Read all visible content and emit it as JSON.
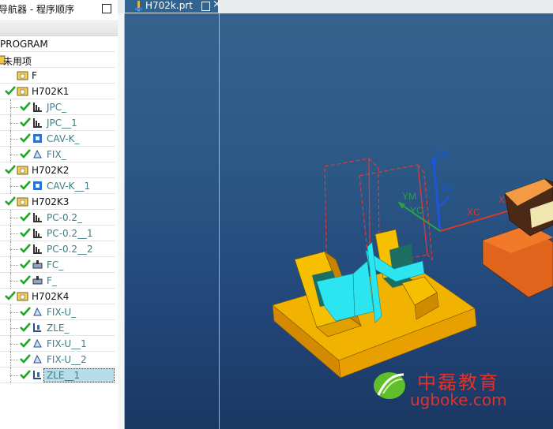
{
  "navigator": {
    "title": "导航器 - 程序顺序",
    "root": "PROGRAM",
    "unused": "未用项",
    "rows": [
      {
        "label": "F",
        "kind": "group",
        "checked": false
      },
      {
        "label": "H702K1",
        "kind": "group",
        "checked": true
      },
      {
        "label": "JPC_",
        "kind": "op",
        "icon": "planar-mill-icon",
        "checked": true
      },
      {
        "label": "JPC__1",
        "kind": "op",
        "icon": "planar-mill-icon",
        "checked": true
      },
      {
        "label": "CAV-K_",
        "kind": "op",
        "icon": "cavity-mill-icon",
        "checked": true
      },
      {
        "label": "FIX_",
        "kind": "op",
        "icon": "fixed-axis-icon",
        "checked": true
      },
      {
        "label": "H702K2",
        "kind": "group",
        "checked": true
      },
      {
        "label": "CAV-K__1",
        "kind": "op",
        "icon": "cavity-mill-icon",
        "checked": true
      },
      {
        "label": "H702K3",
        "kind": "group",
        "checked": true
      },
      {
        "label": "PC-0.2_",
        "kind": "op",
        "icon": "planar-mill-icon",
        "checked": true
      },
      {
        "label": "PC-0.2__1",
        "kind": "op",
        "icon": "planar-mill-icon",
        "checked": true
      },
      {
        "label": "PC-0.2__2",
        "kind": "op",
        "icon": "planar-mill-icon",
        "checked": true
      },
      {
        "label": "FC_",
        "kind": "op",
        "icon": "face-mill-icon",
        "checked": true
      },
      {
        "label": "F_",
        "kind": "op",
        "icon": "face-mill-icon",
        "checked": true
      },
      {
        "label": "H702K4",
        "kind": "group",
        "checked": true
      },
      {
        "label": "FIX-U_",
        "kind": "op",
        "icon": "fixed-axis-icon",
        "checked": true
      },
      {
        "label": "ZLE_",
        "kind": "op",
        "icon": "zlevel-icon",
        "checked": true
      },
      {
        "label": "FIX-U__1",
        "kind": "op",
        "icon": "fixed-axis-icon",
        "checked": true
      },
      {
        "label": "FIX-U__2",
        "kind": "op",
        "icon": "fixed-axis-icon",
        "checked": true
      },
      {
        "label": "ZLE__1",
        "kind": "op",
        "icon": "zlevel-icon",
        "checked": true,
        "selected": true
      }
    ]
  },
  "tab": {
    "label": "H702k.prt",
    "close": "×"
  },
  "viewport": {
    "axes": {
      "zm": "ZM",
      "zc": "ZC",
      "ym": "YM",
      "yc": "YC",
      "xc": "XC",
      "xm": "XM"
    },
    "colors": {
      "part": "#f2b200",
      "insert": "#2de5f0",
      "teal": "#1e6d63",
      "orange": "#e0641c",
      "axis_blue": "#1b57d6",
      "axis_green": "#2aa04a",
      "axis_red": "#d83a2a"
    }
  },
  "watermark": {
    "cn": "中磊教育",
    "url": "ugboke.com"
  }
}
